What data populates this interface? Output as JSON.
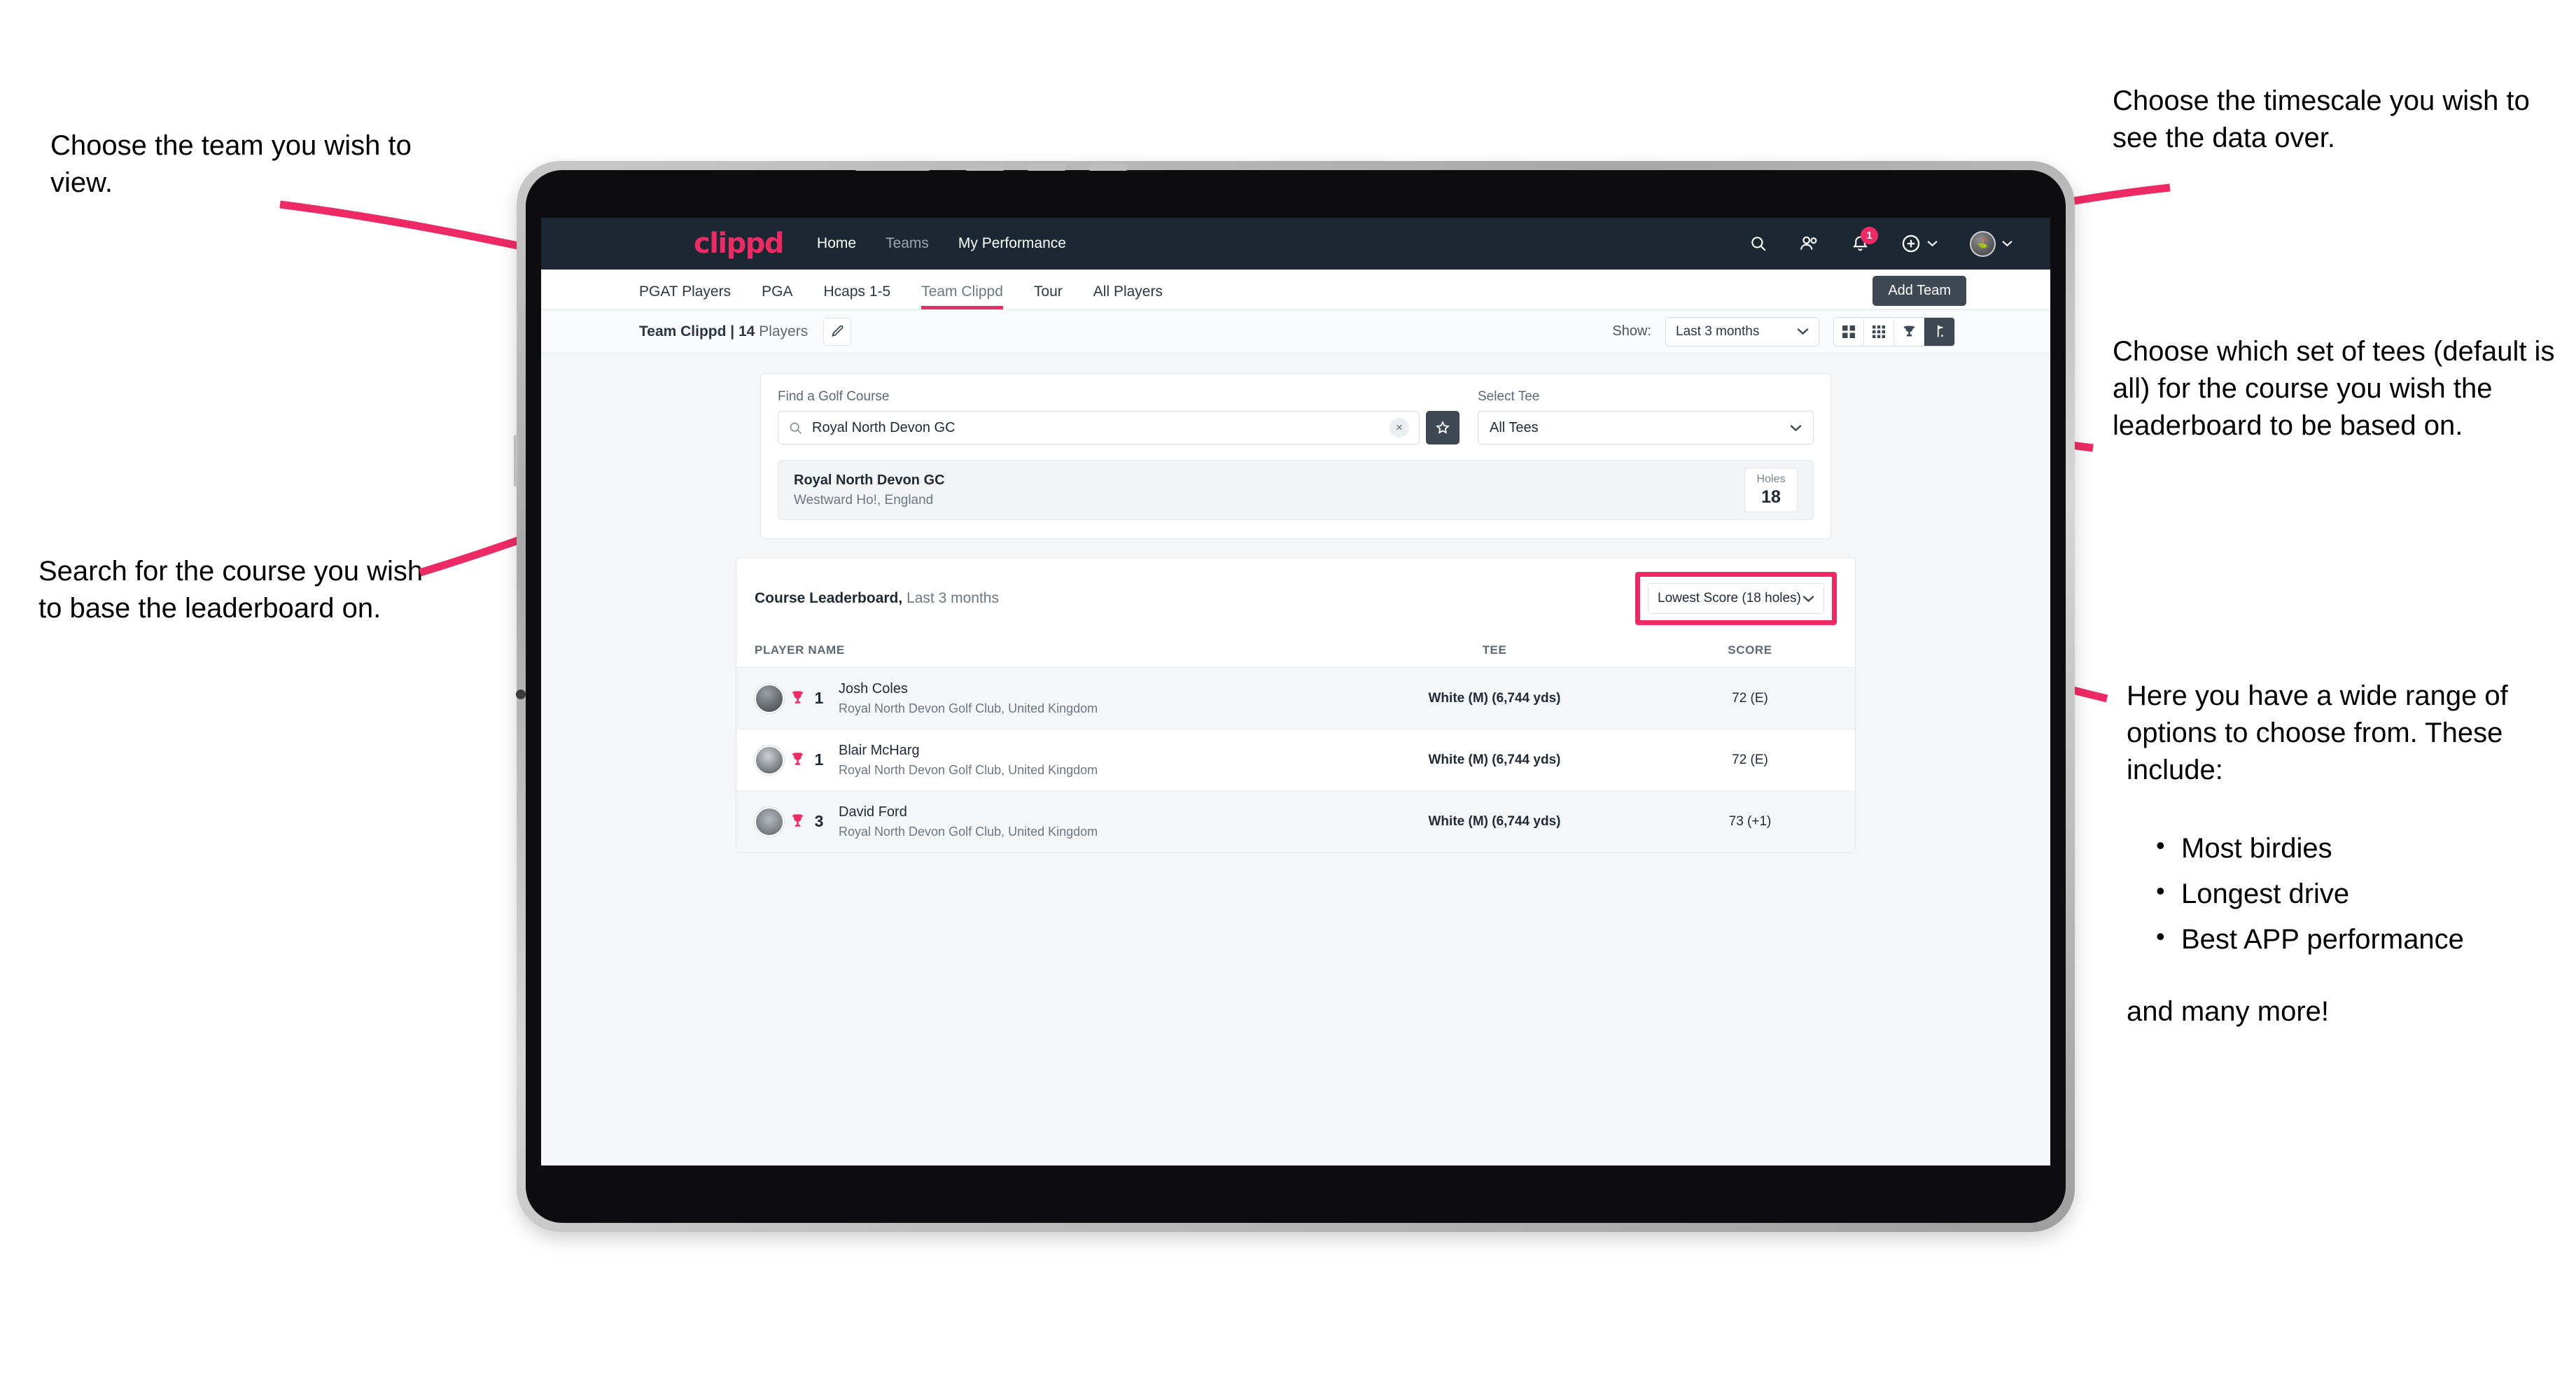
{
  "annotations": {
    "choose_team": "Choose the team you wish to view.",
    "search_course": "Search for the course you wish to base the leaderboard on.",
    "timescale": "Choose the timescale you wish to see the data over.",
    "tees": "Choose which set of tees (default is all) for the course you wish the leaderboard to be based on.",
    "options_intro": "Here you have a wide range of options to choose from. These include:",
    "options_list": [
      "Most birdies",
      "Longest drive",
      "Best APP performance"
    ],
    "options_tail": "and many more!"
  },
  "navbar": {
    "brand": "clippd",
    "links": [
      {
        "label": "Home",
        "dim": false
      },
      {
        "label": "Teams",
        "dim": true
      },
      {
        "label": "My Performance",
        "dim": false
      }
    ],
    "icons": [
      "search-icon",
      "people-icon",
      "bell-icon",
      "plus-circle-icon",
      "avatar"
    ],
    "notification_count": "1"
  },
  "tabs": {
    "items": [
      {
        "label": "PGAT Players",
        "active": false
      },
      {
        "label": "PGA",
        "active": false
      },
      {
        "label": "Hcaps 1-5",
        "active": false
      },
      {
        "label": "Team Clippd",
        "active": true
      },
      {
        "label": "Tour",
        "active": false
      },
      {
        "label": "All Players",
        "active": false
      }
    ],
    "add_team_label": "Add Team"
  },
  "toolbar": {
    "team_name": "Team Clippd",
    "separator": " | ",
    "player_count": "14",
    "players_word": " Players",
    "edit_icon": "pencil-icon",
    "show_label": "Show:",
    "show_value": "Last 3 months",
    "views": [
      {
        "name": "grid-large-view",
        "active": false
      },
      {
        "name": "grid-small-view",
        "active": false
      },
      {
        "name": "trophy-view",
        "active": false
      },
      {
        "name": "course-view",
        "active": true
      }
    ]
  },
  "search": {
    "course_label": "Find a Golf Course",
    "course_value": "Royal North Devon GC",
    "course_placeholder": "Find a Golf Course",
    "clear_label": "×",
    "favourite_icon": "star-icon",
    "tee_label": "Select Tee",
    "tee_value": "All Tees"
  },
  "course_result": {
    "name": "Royal North Devon GC",
    "location": "Westward Ho!, England",
    "holes_label": "Holes",
    "holes_value": "18"
  },
  "leaderboard": {
    "title": "Course Leaderboard,",
    "subtitle": " Last 3 months",
    "sort_value": "Lowest Score (18 holes)",
    "columns": [
      "PLAYER NAME",
      "TEE",
      "SCORE"
    ],
    "rows": [
      {
        "rank": "1",
        "name": "Josh Coles",
        "club": "Royal North Devon Golf Club, United Kingdom",
        "tee": "White (M) (6,744 yds)",
        "score": "72 (E)"
      },
      {
        "rank": "1",
        "name": "Blair McHarg",
        "club": "Royal North Devon Golf Club, United Kingdom",
        "tee": "White (M) (6,744 yds)",
        "score": "72 (E)"
      },
      {
        "rank": "3",
        "name": "David Ford",
        "club": "Royal North Devon Golf Club, United Kingdom",
        "tee": "White (M) (6,744 yds)",
        "score": "73 (+1)"
      }
    ]
  },
  "colors": {
    "accent": "#ee2a64",
    "navbar": "#1b2733",
    "dark_button": "#3d4853"
  }
}
